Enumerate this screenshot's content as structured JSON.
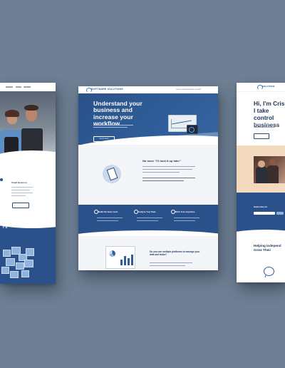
{
  "mockups": {
    "left": {
      "section_heading": "Small Business",
      "section_tail": "r It"
    },
    "center": {
      "logo": "SOFTWARE SOLUTIONS",
      "nav_items": "Home  Services  About  Contact",
      "hero_title": "Understand your business and increase your workflow",
      "hero_sub": "",
      "hero_cta": "Get in touch",
      "quote_title": "No more \"I'll look it up later\"",
      "feature_titles": [
        "Build the basic tools",
        "Analyze Your Data",
        "Work from anywhere"
      ],
      "bottom_title": "Do you use multiple platforms to manage your data and tasks?"
    },
    "right": {
      "logo": "SOLUTIONS",
      "headline": "Hi, I'm Cris. I take control business",
      "subscribe_label": "Subscribe for",
      "help_title": "Helping Independ Grow Their"
    }
  },
  "colors": {
    "background": "#6f7f94",
    "brand_blue": "#2a5189",
    "accent_light_blue": "#8fb3dc",
    "peach": "#f3d9bd",
    "heading_navy": "#1f3556"
  },
  "icons": [
    "clipboard-icon",
    "chat-bubble-icon",
    "pie-chart-icon",
    "logo-mark-icon"
  ]
}
